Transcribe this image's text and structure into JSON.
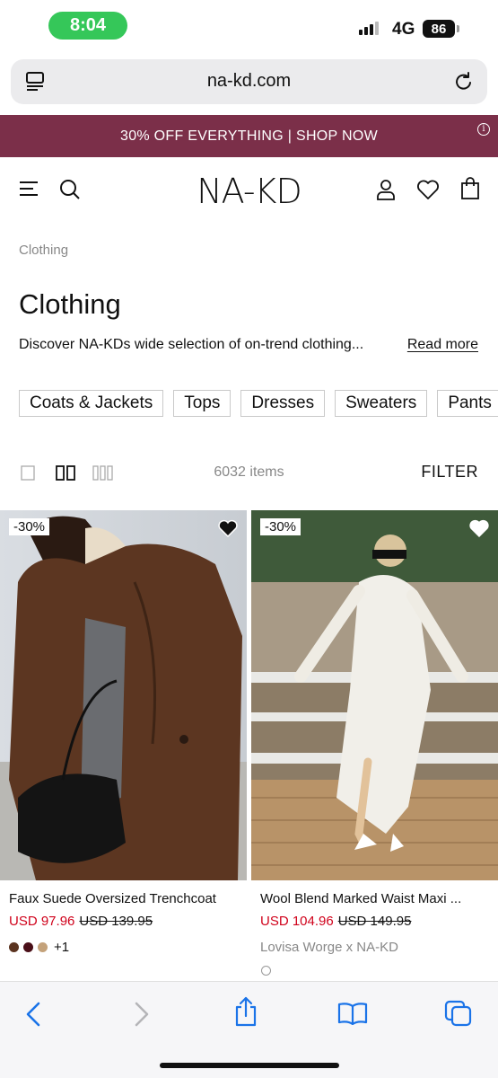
{
  "status_bar": {
    "time": "8:04",
    "network": "4G",
    "battery": "86"
  },
  "browser": {
    "url": "na-kd.com"
  },
  "promo": {
    "text": "30% OFF EVERYTHING | SHOP NOW"
  },
  "header": {
    "logo": "NA-KD"
  },
  "breadcrumb": "Clothing",
  "page": {
    "title": "Clothing",
    "description": "Discover NA-KDs wide selection of on-trend clothing...",
    "read_more": "Read more"
  },
  "categories": [
    "Coats & Jackets",
    "Tops",
    "Dresses",
    "Sweaters",
    "Pants"
  ],
  "listing": {
    "items_count": "6032 items",
    "filter_label": "FILTER"
  },
  "products": [
    {
      "badge": "-30%",
      "name": "Faux Suede Oversized Trenchcoat",
      "price": "USD 97.96",
      "old_price": "USD 139.95",
      "swatches": [
        "#5b3420",
        "#4a0f18",
        "#c4a27a"
      ],
      "more_colors": "+1"
    },
    {
      "badge": "-30%",
      "name": "Wool Blend Marked Waist Maxi ...",
      "price": "USD 104.96",
      "old_price": "USD 149.95",
      "collab": "Lovisa Worge x NA-KD"
    }
  ],
  "colors": {
    "promo_bg": "#7b2f49",
    "sale_red": "#d0021b",
    "toolbar_blue": "#1a73e8",
    "status_green": "#35c759"
  }
}
